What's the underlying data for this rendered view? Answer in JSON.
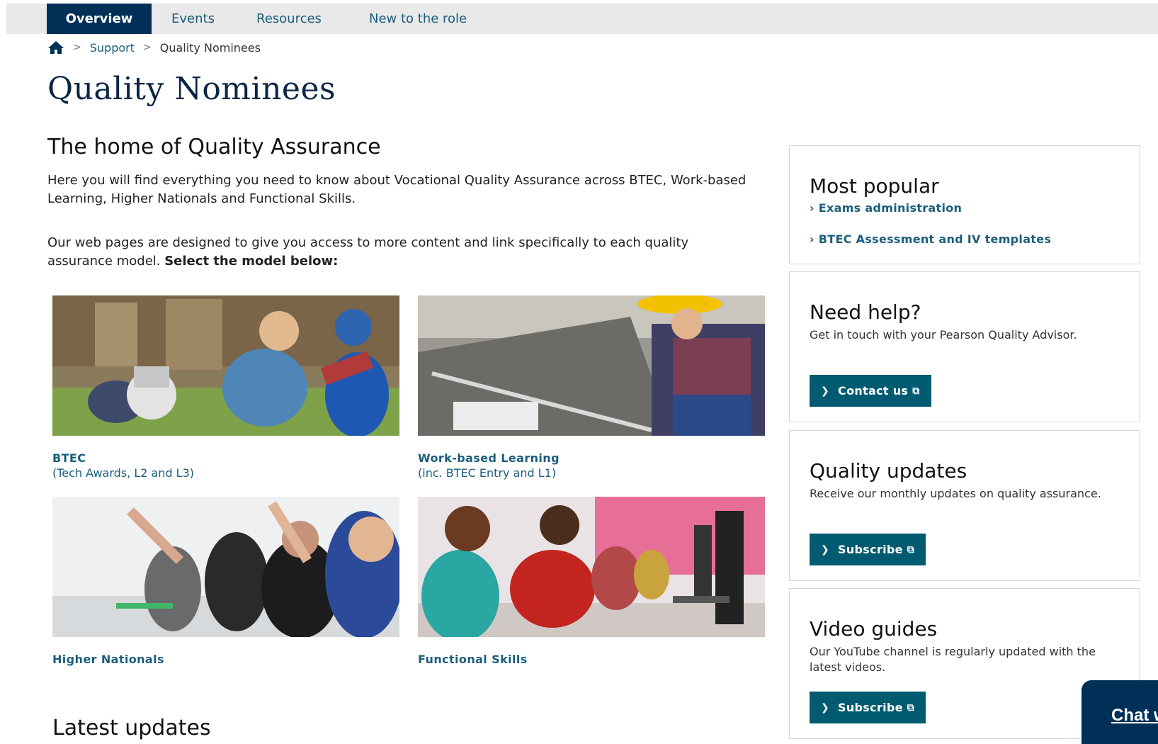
{
  "nav": {
    "tabs": [
      {
        "label": "Overview",
        "active": true
      },
      {
        "label": "Events"
      },
      {
        "label": "Resources"
      },
      {
        "label": "New to the role"
      }
    ]
  },
  "breadcrumb": {
    "home_icon": "home-icon",
    "separator": ">",
    "items": [
      "Support",
      "Quality Nominees"
    ]
  },
  "page": {
    "title": "Quality Nominees",
    "subtitle": "The home of Quality Assurance",
    "intro": "Here you will find everything you need to know about Vocational Quality Assurance across BTEC, Work-based Learning, Higher Nationals and Functional Skills.",
    "para2_start": "Our web pages are designed to give you access to more content and link specifically to each quality assurance model. ",
    "para2_bold": "Select the model below:",
    "latest_heading": "Latest updates"
  },
  "models": [
    {
      "title": "BTEC",
      "subtitle": "(Tech Awards, L2 and L3)"
    },
    {
      "title": "Work-based Learning",
      "subtitle": "(inc. BTEC Entry and L1)"
    },
    {
      "title": "Higher Nationals",
      "subtitle": ""
    },
    {
      "title": "Functional Skills",
      "subtitle": ""
    }
  ],
  "sidebar": {
    "popular": {
      "heading": "Most popular",
      "links": [
        "Exams administration",
        "BTEC Assessment and IV templates"
      ]
    },
    "help": {
      "heading": "Need help?",
      "text": "Get in touch with your Pearson Quality Advisor.",
      "button": "Contact us"
    },
    "updates": {
      "heading": "Quality updates",
      "text": "Receive our monthly updates on quality assurance.",
      "button": "Subscribe"
    },
    "video": {
      "heading": "Video guides",
      "text": "Our YouTube channel is regularly updated with the latest videos.",
      "button": "Subscribe"
    }
  },
  "chat": {
    "label": "Chat w"
  },
  "colors": {
    "nav_active": "#003057",
    "link": "#1b5d7c",
    "button": "#005a70"
  }
}
